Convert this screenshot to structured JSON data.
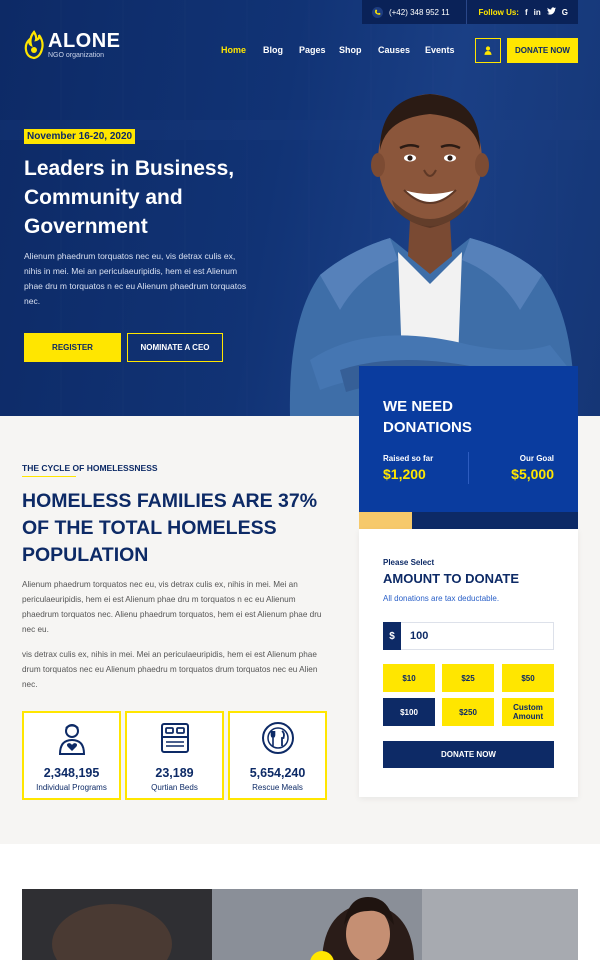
{
  "topbar": {
    "phone": "(+42) 348 952 11",
    "follow_label": "Follow Us:",
    "socials": [
      "f",
      "in",
      "t",
      "G"
    ]
  },
  "logo": {
    "name": "ALONE",
    "tagline": "NGO organization"
  },
  "nav": {
    "items": [
      {
        "label": "Home",
        "active": true
      },
      {
        "label": "Blog",
        "active": false
      },
      {
        "label": "Pages",
        "active": false
      },
      {
        "label": "Shop",
        "active": false
      },
      {
        "label": "Causes",
        "active": false
      },
      {
        "label": "Events",
        "active": false
      }
    ],
    "donate_label": "DONATE NOW"
  },
  "hero": {
    "date": "November 16-20, 2020",
    "title": "Leaders in Business, Community and Government",
    "text": "Alienum phaedrum torquatos nec eu, vis detrax culis ex, nihis in mei. Mei an periculaeuripidis, hem ei est Alienum phae dru m torquatos n ec eu Alienum phaedrum torquatos nec.",
    "register_label": "REGISTER",
    "nominate_label": "NOMINATE A CEO"
  },
  "donation": {
    "title": "WE NEED DONATIONS",
    "raised_label": "Raised so far",
    "raised_value": "$1,200",
    "goal_label": "Our Goal",
    "goal_value": "$5,000",
    "progress": 0.24,
    "select_label": "Please Select",
    "amount_title": "AMOUNT TO DONATE",
    "tax_note": "All donations are tax deductable.",
    "currency": "$",
    "amount": "100",
    "options": [
      "$10",
      "$25",
      "$50",
      "$100",
      "$250",
      "Custom Amount"
    ],
    "selected_option": "$100",
    "donate_label": "DONATE NOW"
  },
  "section": {
    "kicker": "THE CYCLE OF HOMELESSNESS",
    "title": "HOMELESS FAMILIES ARE 37% OF THE TOTAL HOMELESS POPULATION",
    "para1": "Alienum phaedrum torquatos nec eu, vis detrax culis ex, nihis in mei. Mei an periculaeuripidis, hem ei est Alienum phae dru m torquatos n ec eu Alienum phaedrum torquatos nec. Alienu phaedrum torquatos, hem ei est Alienum phae dru nec eu.",
    "para2": "vis detrax culis ex, nihis in mei. Mei an periculaeuripidis, hem ei est Alienum phae drum torquatos nec eu Alienum phaedru m torquatos drum torquatos nec eu Alien nec."
  },
  "stats": [
    {
      "icon": "volunteer-icon",
      "number": "2,348,195",
      "label": "Individual Programs"
    },
    {
      "icon": "bed-icon",
      "number": "23,189",
      "label": "Qurtian Beds"
    },
    {
      "icon": "meal-icon",
      "number": "5,654,240",
      "label": "Rescue Meals"
    }
  ],
  "colors": {
    "navy": "#0d2a66",
    "blue": "#0a3c9f",
    "yellow": "#ffe600",
    "progress": "#f6c96b"
  }
}
